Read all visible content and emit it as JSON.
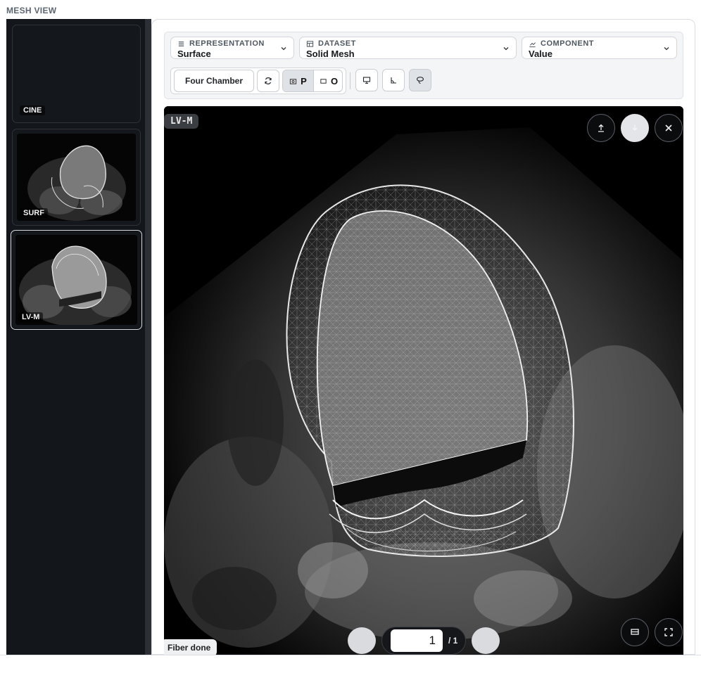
{
  "app": {
    "title": "MESH VIEW"
  },
  "sidebar": {
    "items": [
      {
        "label": "CINE"
      },
      {
        "label": "SURF"
      },
      {
        "label": "LV-M"
      }
    ]
  },
  "toolbar": {
    "representation": {
      "caption": "REPRESENTATION",
      "value": "Surface"
    },
    "dataset": {
      "caption": "DATASET",
      "value": "Solid Mesh"
    },
    "component": {
      "caption": "COMPONENT",
      "value": "Value"
    },
    "view_button": "Four Chamber",
    "projection": {
      "perspective": "P",
      "orthographic": "O"
    }
  },
  "viewer": {
    "badge": "LV-M",
    "pager": {
      "current": "1",
      "total": "/ 1"
    },
    "status": "Fiber done"
  },
  "icons": [
    "list-icon",
    "table-icon",
    "chart-line-icon",
    "chevron-down-icon",
    "refresh-icon",
    "camera-icon",
    "square-icon",
    "monitor-icon",
    "angle-icon",
    "lasso-icon",
    "upload-icon",
    "download-icon",
    "close-icon",
    "fit-icon",
    "fullscreen-icon"
  ],
  "colors": {
    "accent_selected": "#d8dce1",
    "sidebar_bg": "#13161b",
    "viewer_bg": "#000000"
  }
}
